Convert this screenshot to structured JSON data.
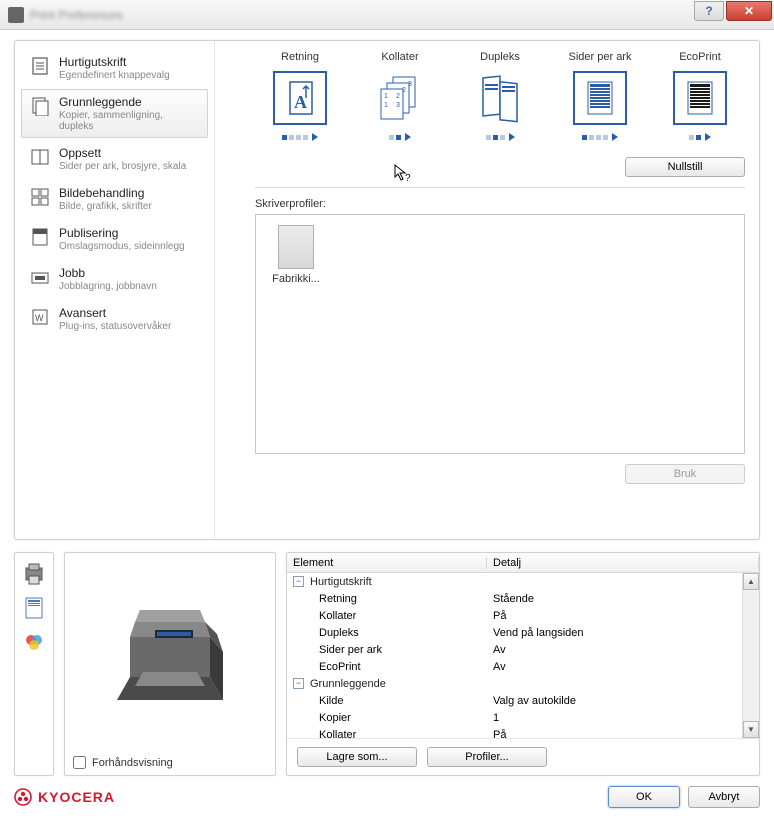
{
  "titlebar": {
    "title": "Print Preferences"
  },
  "sidebar": [
    {
      "title": "Hurtigutskrift",
      "sub": "Egendefinert knappevalg"
    },
    {
      "title": "Grunnleggende",
      "sub": "Kopier, sammenligning, dupleks"
    },
    {
      "title": "Oppsett",
      "sub": "Sider per ark, brosjyre, skala"
    },
    {
      "title": "Bildebehandling",
      "sub": "Bilde, grafikk, skrifter"
    },
    {
      "title": "Publisering",
      "sub": "Omslagsmodus, sideinnlegg"
    },
    {
      "title": "Jobb",
      "sub": "Jobblagring, jobbnavn"
    },
    {
      "title": "Avansert",
      "sub": "Plug-ins, statusovervåker"
    }
  ],
  "quick": {
    "items": [
      "Retning",
      "Kollater",
      "Dupleks",
      "Sider per ark",
      "EcoPrint"
    ],
    "reset": "Nullstill"
  },
  "profiles": {
    "label": "Skriverprofiler:",
    "item": "Fabrikki...",
    "use": "Bruk"
  },
  "details": {
    "headers": {
      "c1": "Element",
      "c2": "Detalj"
    },
    "groups": [
      {
        "name": "Hurtigutskrift",
        "rows": [
          {
            "k": "Retning",
            "v": "Stående"
          },
          {
            "k": "Kollater",
            "v": "På"
          },
          {
            "k": "Dupleks",
            "v": "Vend på langsiden"
          },
          {
            "k": "Sider per ark",
            "v": "Av"
          },
          {
            "k": "EcoPrint",
            "v": "Av"
          }
        ]
      },
      {
        "name": "Grunnleggende",
        "rows": [
          {
            "k": "Kilde",
            "v": "Valg av autokilde"
          },
          {
            "k": "Kopier",
            "v": "1"
          },
          {
            "k": "Kollater",
            "v": "På"
          }
        ]
      }
    ],
    "save_as": "Lagre som...",
    "profiles_btn": "Profiler..."
  },
  "preview_label": "Forhåndsvisning",
  "brand": "KYOCERA",
  "footer": {
    "ok": "OK",
    "cancel": "Avbryt"
  }
}
